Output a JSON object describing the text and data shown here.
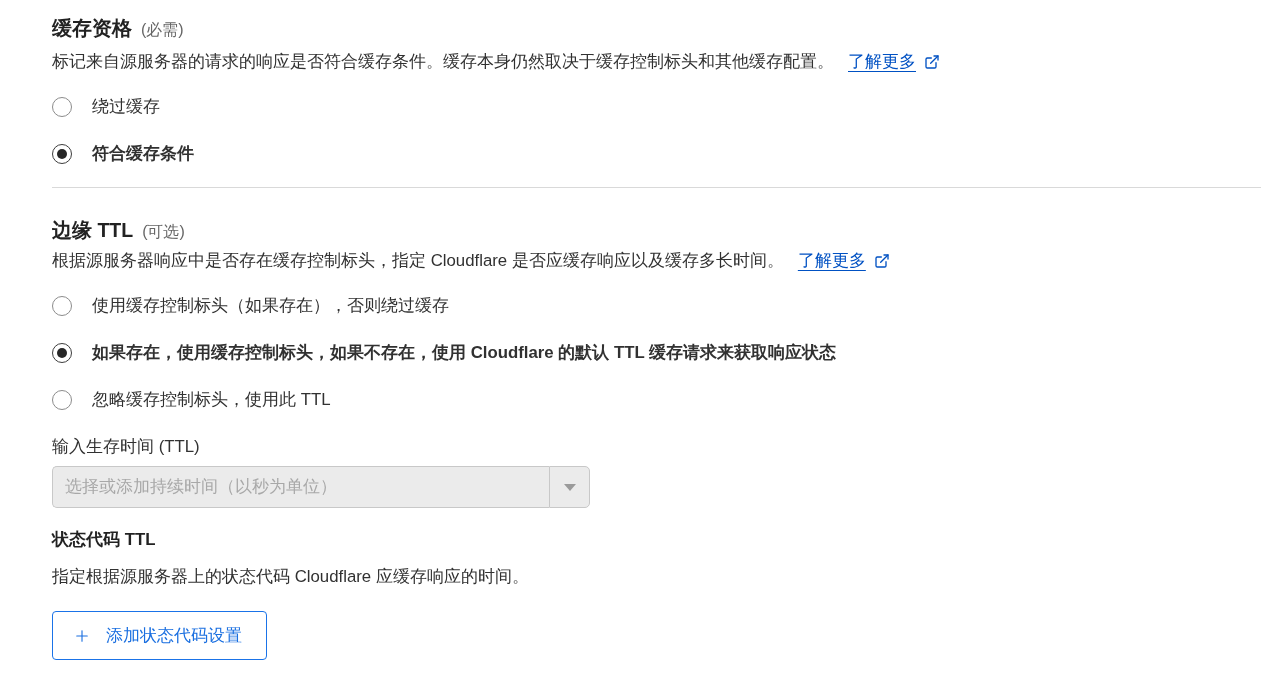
{
  "sections": [
    {
      "kind": "radio_group",
      "title": "缓存资格",
      "tag": "(必需)",
      "description": "标记来自源服务器的请求的响应是否符合缓存条件。缓存本身仍然取决于缓存控制标头和其他缓存配置。",
      "link": "了解更多",
      "options": [
        {
          "label": "绕过缓存",
          "selected": false
        },
        {
          "label": "符合缓存条件",
          "selected": true
        }
      ]
    },
    {
      "kind": "radio_group",
      "title": "边缘 TTL",
      "tag": "(可选)",
      "description": "根据源服务器响应中是否存在缓存控制标头，指定 Cloudflare 是否应缓存响应以及缓存多长时间。",
      "link": "了解更多",
      "options": [
        {
          "label": "使用缓存控制标头（如果存在），否则绕过缓存",
          "selected": false
        },
        {
          "label": "如果存在，使用缓存控制标头，如果不存在，使用 Cloudflare 的默认 TTL 缓存请求来获取响应状态",
          "selected": true
        },
        {
          "label": "忽略缓存控制标头，使用此 TTL",
          "selected": false
        }
      ],
      "field": {
        "label": "输入生存时间 (TTL)",
        "placeholder": "选择或添加持续时间（以秒为单位）",
        "disabled": true
      }
    }
  ],
  "status_code_ttl": {
    "title": "状态代码 TTL",
    "description": "指定根据源服务器上的状态代码 Cloudflare 应缓存响应的时间。",
    "button": "添加状态代码设置"
  }
}
